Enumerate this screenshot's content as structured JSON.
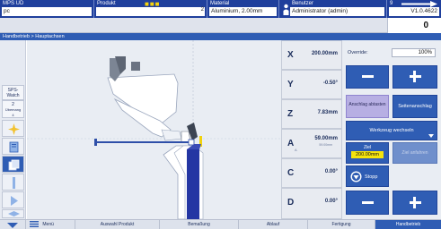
{
  "header": {
    "app_name": "MPS UD",
    "app_sub": "pc",
    "produkt_label": "Produkt",
    "produkt_value": "",
    "produkt_count": "2",
    "material_label": "Material",
    "material_value": "Aluminium, 2.00mm",
    "benutzer_label": "Benutzer",
    "benutzer_value": "Administrator (admin)",
    "signal_value": "9",
    "version": "V1.0.4622",
    "counter": "0",
    "dots": "■■■"
  },
  "breadcrumb": "Handbetrieb > Hauptachsen",
  "sidebar": {
    "sps_watch": "SPS-Watch",
    "item_2": "2",
    "ubemang_label": "Übemang",
    "item_4": "4"
  },
  "axes": [
    {
      "name": "X",
      "value": "200.00mm",
      "sub": ""
    },
    {
      "name": "Y",
      "value": "-0.50°",
      "sub": ""
    },
    {
      "name": "Z",
      "value": "7.83mm",
      "sub": ""
    },
    {
      "name": "A",
      "value": "59.00mm",
      "sub": "59.00mm",
      "sub2": "A"
    },
    {
      "name": "C",
      "value": "0.00°",
      "sub": ""
    },
    {
      "name": "D",
      "value": "0.00°",
      "sub": ""
    }
  ],
  "panel": {
    "override_label": "Override:",
    "override_value": "100%",
    "anschlag_label": "Anschlag abtasten",
    "seitenanschlag_label": "Seitenanschlag",
    "werkzeug_label": "Werkzeug wechseln",
    "ziel_label": "Ziel",
    "ziel_value": "200.00mm",
    "ziel_anfahren_label": "Ziel anfahren",
    "stopp_label": "Stopp"
  },
  "footer": {
    "menu": "Menü",
    "auswahl": "Auswahl Produkt",
    "bemassung": "Bemaßung",
    "ablauf": "Ablauf",
    "fertigung": "Fertigung",
    "handbetrieb": "Handbetrieb"
  },
  "colors": {
    "header_bg": "#1f3f9c",
    "button_blue": "#2f5db4",
    "highlight_yellow": "#f5e40c",
    "purple_button": "#b7afe3"
  }
}
